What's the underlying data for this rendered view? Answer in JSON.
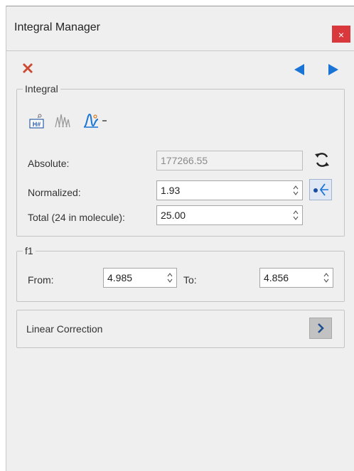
{
  "window": {
    "title": "Integral Manager",
    "close_glyph": "×"
  },
  "toolbar": {
    "delete_icon": "delete-icon",
    "prev_icon": "prev-arrow-icon",
    "next_icon": "next-arrow-icon"
  },
  "integral": {
    "legend": "Integral",
    "absolute_label": "Absolute:",
    "absolute_value": "177266.55",
    "normalized_label": "Normalized:",
    "normalized_value": "1.93",
    "total_label": "Total (24 in molecule):",
    "total_value": "25.00",
    "hash_icon_text": "H#"
  },
  "f1": {
    "legend": "f1",
    "from_label": "From:",
    "from_value": "4.985",
    "to_label": "To:",
    "to_value": "4.856"
  },
  "linear_correction": {
    "label": "Linear Correction"
  },
  "colors": {
    "accent": "#1a74d6",
    "close": "#d9383d",
    "delete": "#cc4a2f"
  }
}
